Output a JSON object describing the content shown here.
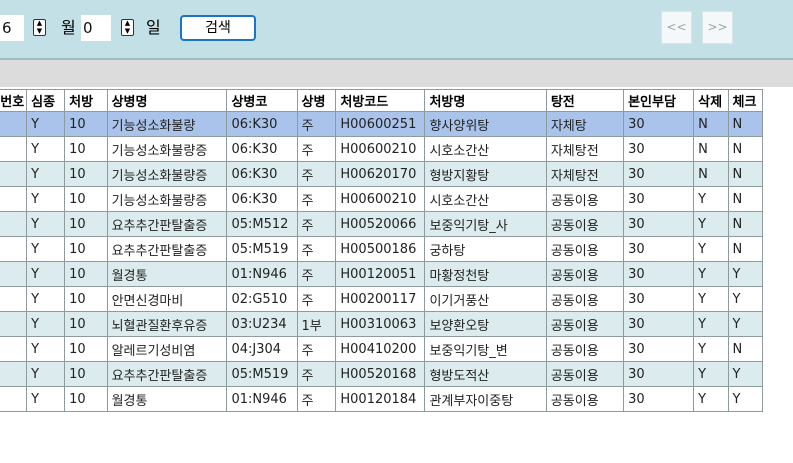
{
  "toolbar": {
    "month_value": "6",
    "month_unit": "월",
    "day_value": "0",
    "day_unit": "일",
    "search_label": "검색",
    "prev_label": "<<",
    "next_label": ">>"
  },
  "grid": {
    "columns": [
      "번호",
      "심종",
      "처방",
      "상병명",
      "상병코",
      "상병",
      "처방코드",
      "처방명",
      "탕전",
      "본인부담",
      "삭제",
      "체크"
    ],
    "rows": [
      [
        "",
        "Y",
        "10",
        "기능성소화불량",
        "06:K30",
        "주",
        "H00600251",
        "향사양위탕",
        "자체탕",
        "30",
        "N",
        "N"
      ],
      [
        "",
        "Y",
        "10",
        "기능성소화불량증",
        "06:K30",
        "주",
        "H00600210",
        "시호소간산",
        "자체탕전",
        "30",
        "N",
        "N"
      ],
      [
        "",
        "Y",
        "10",
        "기능성소화불량증",
        "06:K30",
        "주",
        "H00620170",
        "형방지황탕",
        "자체탕전",
        "30",
        "N",
        "N"
      ],
      [
        "",
        "Y",
        "10",
        "기능성소화불량증",
        "06:K30",
        "주",
        "H00600210",
        "시호소간산",
        "공동이용",
        "30",
        "Y",
        "N"
      ],
      [
        "",
        "Y",
        "10",
        "요추추간판탈출증",
        "05:M512",
        "주",
        "H00520066",
        "보중익기탕_사",
        "공동이용",
        "30",
        "Y",
        "N"
      ],
      [
        "",
        "Y",
        "10",
        "요추추간판탈출증",
        "05:M519",
        "주",
        "H00500186",
        "궁하탕",
        "공동이용",
        "30",
        "Y",
        "N"
      ],
      [
        "",
        "Y",
        "10",
        "월경통",
        "01:N946",
        "주",
        "H00120051",
        "마황정천탕",
        "공동이용",
        "30",
        "Y",
        "Y"
      ],
      [
        "",
        "Y",
        "10",
        "안면신경마비",
        "02:G510",
        "주",
        "H00200117",
        "이기거풍산",
        "공동이용",
        "30",
        "Y",
        "Y"
      ],
      [
        "",
        "Y",
        "10",
        "뇌혈관질환후유증",
        "03:U234",
        "1부",
        "H00310063",
        "보양환오탕",
        "공동이용",
        "30",
        "Y",
        "Y"
      ],
      [
        "",
        "Y",
        "10",
        "알레르기성비염",
        "04:J304",
        "주",
        "H00410200",
        "보중익기탕_변",
        "공동이용",
        "30",
        "Y",
        "N"
      ],
      [
        "",
        "Y",
        "10",
        "요추추간판탈출증",
        "05:M519",
        "주",
        "H00520168",
        "형방도적산",
        "공동이용",
        "30",
        "Y",
        "Y"
      ],
      [
        "",
        "Y",
        "10",
        "월경통",
        "01:N946",
        "주",
        "H00120184",
        "관계부자이중탕",
        "공동이용",
        "30",
        "Y",
        "Y"
      ]
    ]
  }
}
